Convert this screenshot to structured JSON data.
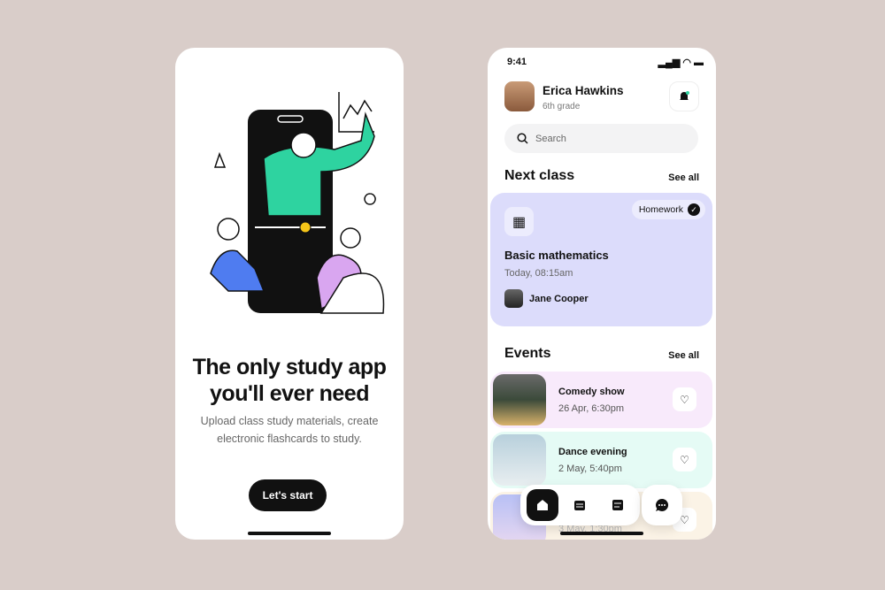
{
  "onboarding": {
    "headline_line1": "The only study app",
    "headline_line2": "you'll  ever need",
    "subtitle": "Upload class study materials, create electronic flashcards to study.",
    "start_label": "Let's start"
  },
  "home": {
    "status": {
      "time": "9:41"
    },
    "user": {
      "name": "Erica Hawkins",
      "grade": "6th grade"
    },
    "search": {
      "placeholder": "Search"
    },
    "next_class": {
      "title": "Next class",
      "see_all": "See all",
      "badge": "Homework",
      "class_name": "Basic mathematics",
      "time": "Today, 08:15am",
      "teacher": "Jane Cooper",
      "color": "#dcdcfb"
    },
    "events": {
      "title": "Events",
      "see_all": "See all",
      "items": [
        {
          "title": "Comedy show",
          "date": "26 Apr, 6:30pm",
          "color": "#f8eafb"
        },
        {
          "title": "Dance evening",
          "date": "2 May, 5:40pm",
          "color": "#e5fbf5"
        },
        {
          "title": "",
          "date": "3 May, 1:30pm",
          "color": "#fbf3e6"
        }
      ]
    },
    "nav": [
      "home-icon",
      "calendar-icon",
      "notes-icon",
      "chat-icon"
    ],
    "accent": "#2ed3a0"
  }
}
